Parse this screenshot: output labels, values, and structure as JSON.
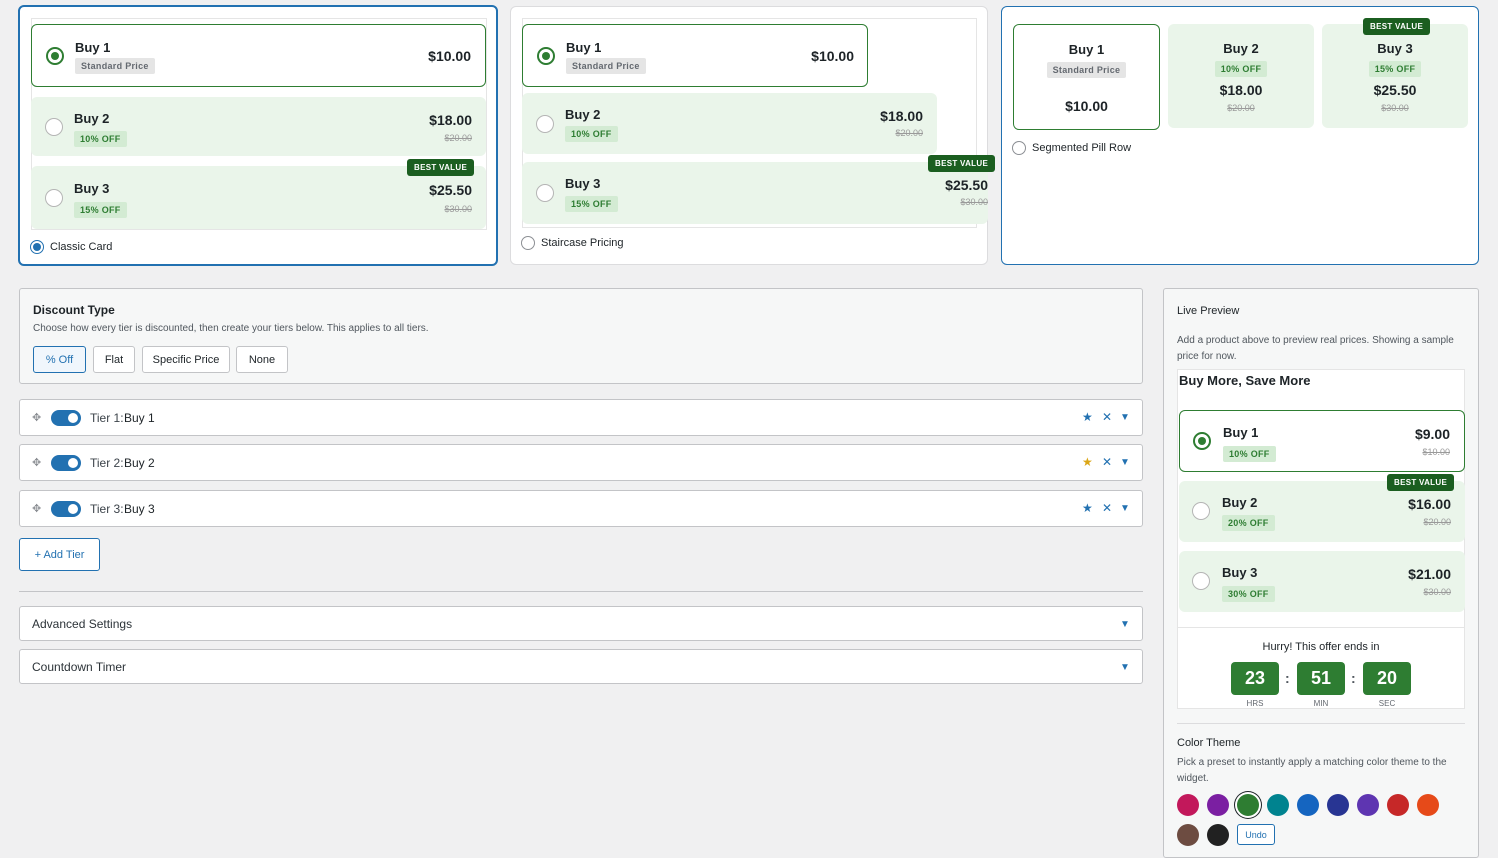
{
  "layouts": [
    {
      "label": "Classic Card",
      "selected": true,
      "options": [
        {
          "qty": "Buy 1",
          "tag": "Standard Price",
          "price": "$10.00",
          "original": ""
        },
        {
          "qty": "Buy 2",
          "tag": "10% OFF",
          "price": "$18.00",
          "original": "$20.00"
        },
        {
          "qty": "Buy 3",
          "tag": "15% OFF",
          "price": "$25.50",
          "original": "$30.00",
          "badge": "BEST VALUE"
        }
      ]
    },
    {
      "label": "Staircase Pricing",
      "selected": false,
      "options": [
        {
          "qty": "Buy 1",
          "tag": "Standard Price",
          "price": "$10.00",
          "original": ""
        },
        {
          "qty": "Buy 2",
          "tag": "10% OFF",
          "price": "$18.00",
          "original": "$20.00"
        },
        {
          "qty": "Buy 3",
          "tag": "15% OFF",
          "price": "$25.50",
          "original": "$30.00",
          "badge": "BEST VALUE"
        }
      ]
    },
    {
      "label": "Segmented Pill Row",
      "selected": false,
      "options": [
        {
          "qty": "Buy 1",
          "tag": "Standard Price",
          "price": "$10.00",
          "original": ""
        },
        {
          "qty": "Buy 2",
          "tag": "10% OFF",
          "price": "$18.00",
          "original": "$20.00"
        },
        {
          "qty": "Buy 3",
          "tag": "15% OFF",
          "price": "$25.50",
          "original": "$30.00",
          "badge": "BEST VALUE"
        }
      ]
    }
  ],
  "discount": {
    "title": "Discount Type",
    "description": "Choose how every tier is discounted, then create your tiers below. This applies to all tiers.",
    "types": [
      "% Off",
      "Flat",
      "Specific Price",
      "None"
    ],
    "selected": "% Off"
  },
  "tiers": [
    {
      "prefix": "Tier 1:",
      "name": "Buy 1",
      "enabled": true,
      "starred": false
    },
    {
      "prefix": "Tier 2:",
      "name": "Buy 2",
      "enabled": true,
      "starred": true
    },
    {
      "prefix": "Tier 3:",
      "name": "Buy 3",
      "enabled": true,
      "starred": false
    }
  ],
  "add_tier_label": "+ Add Tier",
  "sections": [
    "Advanced Settings",
    "Countdown Timer"
  ],
  "preview": {
    "title": "Live Preview",
    "note": "Add a product above to preview real prices. Showing a sample price for now.",
    "widget_title": "Buy More, Save More",
    "options": [
      {
        "qty": "Buy 1",
        "tag": "10% OFF",
        "price": "$9.00",
        "original": "$10.00",
        "selected": true
      },
      {
        "qty": "Buy 2",
        "tag": "20% OFF",
        "price": "$16.00",
        "original": "$20.00",
        "badge": "BEST VALUE"
      },
      {
        "qty": "Buy 3",
        "tag": "30% OFF",
        "price": "$21.00",
        "original": "$30.00"
      }
    ],
    "countdown": {
      "heading": "Hurry! This offer ends in",
      "hours": "23",
      "minutes": "51",
      "seconds": "20",
      "hours_label": "HRS",
      "minutes_label": "MIN",
      "seconds_label": "SEC",
      "separator": ":"
    }
  },
  "theme": {
    "title": "Color Theme",
    "description": "Pick a preset to instantly apply a matching color theme to the widget.",
    "swatches": [
      "#c2185b",
      "#7b1fa2",
      "#2e7d32",
      "#00838f",
      "#1565c0",
      "#283593",
      "#5e35b1",
      "#c62828",
      "#e64a19",
      "#6d4c41",
      "#212121"
    ],
    "selected_swatch": "#2e7d32",
    "undo_label": "Undo"
  },
  "icons": {
    "drag": "drag-handle-icon",
    "star": "star-icon",
    "close": "close-icon",
    "expand": "chevron-down-icon"
  },
  "colors": {
    "accent": "#2271b1",
    "green": "#2e7d32",
    "best_value": "#1b5e20",
    "star_active": "#dba617"
  }
}
